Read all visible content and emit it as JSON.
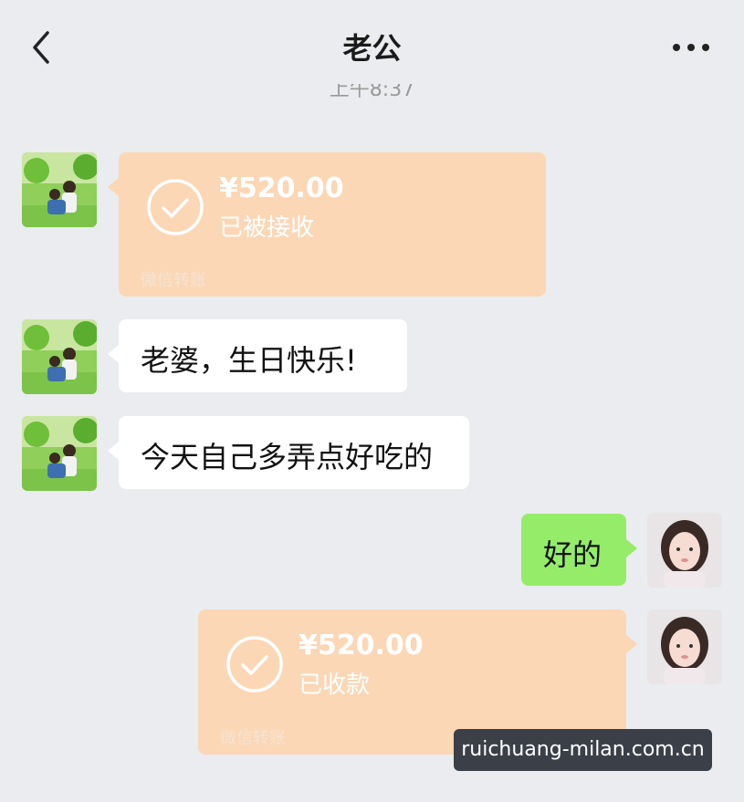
{
  "header": {
    "title": "老公",
    "time": "上午8:37"
  },
  "messages": {
    "m1": {
      "amount": "¥520.00",
      "status": "已被接收",
      "footer": "微信转账"
    },
    "m2": {
      "text": "老婆，生日快乐!"
    },
    "m3": {
      "text": "今天自己多弄点好吃的"
    },
    "m4": {
      "text": "好的"
    },
    "m5": {
      "amount": "¥520.00",
      "status": "已收款",
      "footer": "微信转账"
    }
  },
  "watermark": "ruichuang-milan.com.cn",
  "colors": {
    "background": "#eaecef",
    "green_bubble": "#95ec69",
    "transfer_bubble": "#fbd7b6"
  },
  "icons": [
    "back-arrow-icon",
    "more-dots-icon",
    "check-circle-icon"
  ]
}
